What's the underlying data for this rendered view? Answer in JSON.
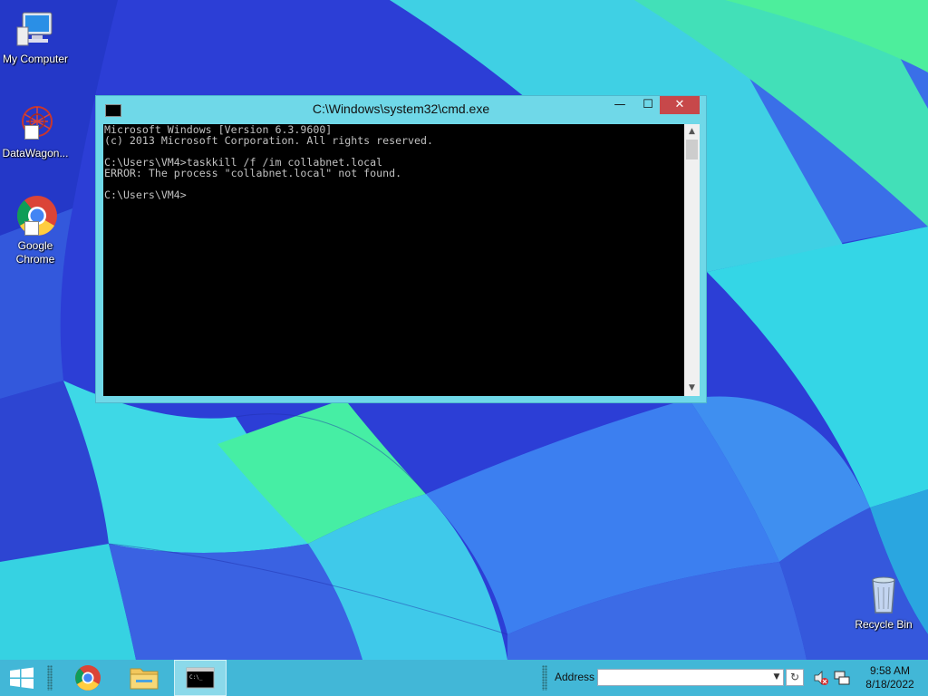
{
  "desktop": {
    "icons": [
      {
        "label": "My Computer",
        "icon": "computer-icon"
      },
      {
        "label": "DataWagon...",
        "icon": "datawagon-icon"
      },
      {
        "label": "Google\nChrome",
        "icon": "chrome-icon"
      },
      {
        "label": "Recycle Bin",
        "icon": "recycle-bin-icon"
      }
    ]
  },
  "cmd_window": {
    "title": "C:\\Windows\\system32\\cmd.exe",
    "minimize_label": "—",
    "maximize_label": "☐",
    "close_label": "✕",
    "console_text": "Microsoft Windows [Version 6.3.9600]\n(c) 2013 Microsoft Corporation. All rights reserved.\n\nC:\\Users\\VM4>taskkill /f /im collabnet.local\nERROR: The process \"collabnet.local\" not found.\n\nC:\\Users\\VM4>"
  },
  "taskbar": {
    "address_label": "Address",
    "address_value": "",
    "clock_time": "9:58 AM",
    "clock_date": "8/18/2022",
    "buttons": [
      "start-button",
      "chrome",
      "file-explorer",
      "cmd"
    ]
  },
  "colors": {
    "taskbar": "#46c8d7",
    "window_frame": "#6fd8e8",
    "close_button": "#c7484a"
  }
}
